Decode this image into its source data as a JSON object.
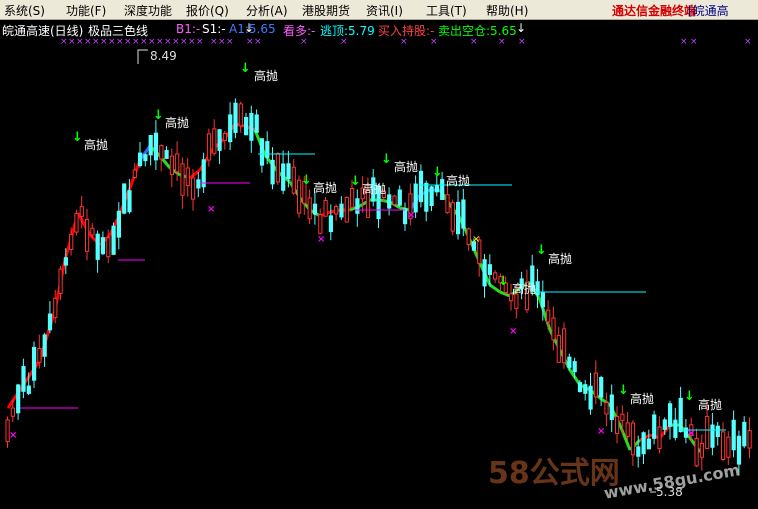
{
  "menubar": {
    "items": [
      "系统(S)",
      "功能(F)",
      "深度功能",
      "报价(Q)",
      "分析(A)",
      "港股期货",
      "资讯(I)",
      "工具(T)",
      "帮助(H)"
    ],
    "app_title": "通达信金融终端",
    "stock_title": "[皖通高"
  },
  "indicator": {
    "stock": "皖通高速(日线)",
    "name": "极品三色线",
    "b1": "B1:-",
    "s1": "S1:-",
    "a1": "A1:5.65",
    "bull": "看多:-",
    "escape": "逃顶:5.79",
    "buy_hold": "买入持股:-",
    "sell_clear": "卖出空仓:5.65"
  },
  "chart_labels": {
    "high_price": "8.49",
    "low_price": "5.38",
    "signal": "高抛"
  },
  "colors": {
    "up": "#ff3232",
    "down": "#54ffff",
    "line_red": "#ff0000",
    "line_green": "#22dd22",
    "line_blue": "#3366ff",
    "signal_green": "#00ff00",
    "magenta": "#ff00ff",
    "cross": "#c040ff",
    "yellow": "#ffff00",
    "cyan_label": "#00ffff"
  },
  "watermark": {
    "brand": "58公式网",
    "url": "www.58gu.com"
  }
}
